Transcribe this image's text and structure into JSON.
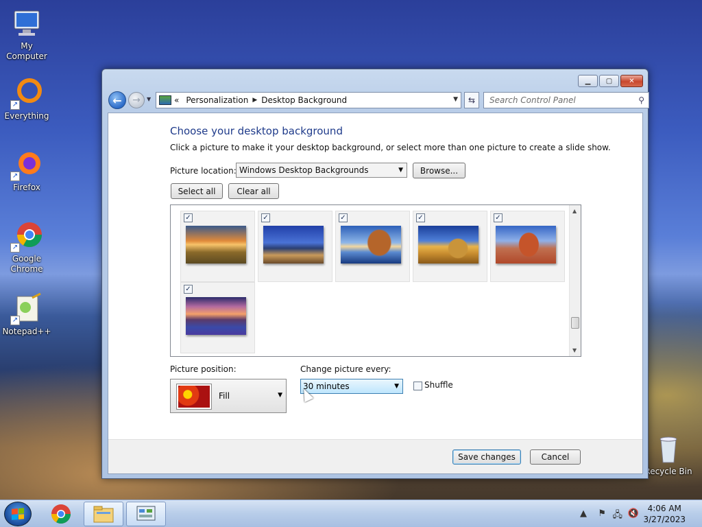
{
  "desktop": {
    "icons": [
      {
        "label": "My Computer",
        "icon": "my-computer-icon"
      },
      {
        "label": "Everything",
        "icon": "everything-icon"
      },
      {
        "label": "Firefox",
        "icon": "firefox-icon"
      },
      {
        "label": "Google Chrome",
        "icon": "chrome-icon"
      },
      {
        "label": "Notepad++",
        "icon": "notepadpp-icon"
      },
      {
        "label": "Recycle Bin",
        "icon": "recycle-bin-icon"
      }
    ]
  },
  "window": {
    "breadcrumb": {
      "overflow": "«",
      "items": [
        "Personalization",
        "Desktop Background"
      ]
    },
    "search_placeholder": "Search Control Panel",
    "heading": "Choose your desktop background",
    "subtext": "Click a picture to make it your desktop background, or select more than one picture to create a slide show.",
    "picture_location_label": "Picture location:",
    "picture_location_value": "Windows Desktop Backgrounds",
    "browse_label": "Browse...",
    "select_all_label": "Select all",
    "clear_all_label": "Clear all",
    "pictures": [
      {
        "name": "sunset-field",
        "checked": true
      },
      {
        "name": "lighthouse",
        "checked": true
      },
      {
        "name": "rock-beach",
        "checked": true
      },
      {
        "name": "hay-bale",
        "checked": true
      },
      {
        "name": "arch-rock",
        "checked": true
      },
      {
        "name": "lake-flowers",
        "checked": true
      }
    ],
    "picture_position_label": "Picture position:",
    "picture_position_value": "Fill",
    "change_every_label": "Change picture every:",
    "change_every_value": "30 minutes",
    "shuffle_label": "Shuffle",
    "shuffle_checked": false,
    "save_label": "Save changes",
    "cancel_label": "Cancel"
  },
  "taskbar": {
    "clock_time": "4:06 AM",
    "clock_date": "3/27/2023",
    "tray_expand": "▲"
  },
  "colors": {
    "heading": "#1e3a8a",
    "accent": "#3c7fb1"
  }
}
